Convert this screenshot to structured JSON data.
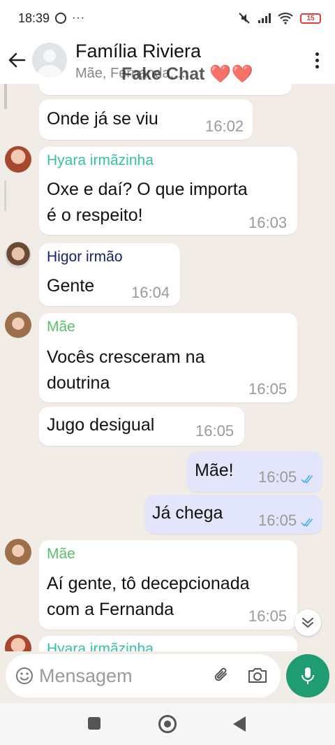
{
  "status_bar": {
    "time": "18:39",
    "dots": "···",
    "battery": "15"
  },
  "header": {
    "title": "Família Riviera",
    "subtitle": "Mãe, Fernanda, ...",
    "watermark": "Fake Chat ❤️❤️"
  },
  "colors": {
    "accent_green": "#1f9c72",
    "sender_hyara": "#35c2a0",
    "sender_higor": "#1b1f6b",
    "sender_mae": "#5bbf6a",
    "tick_blue": "#4fb1e9"
  },
  "messages": [
    {
      "type": "incoming",
      "text": "Onde já se viu",
      "time": "16:02"
    },
    {
      "type": "incoming",
      "sender": "Hyara irmãzinha",
      "text_line1": "Oxe e daí? O que importa",
      "text_line2": "é o respeito!",
      "time": "16:03"
    },
    {
      "type": "incoming",
      "sender": "Higor irmão",
      "text": "Gente",
      "time": "16:04"
    },
    {
      "type": "incoming",
      "sender": "Mãe",
      "text_line1": "Vocês cresceram na",
      "text_line2": "doutrina",
      "time": "16:05"
    },
    {
      "type": "incoming",
      "text": "Jugo desigual",
      "time": "16:05"
    },
    {
      "type": "outgoing",
      "text": "Mãe!",
      "time": "16:05",
      "ticks": "read"
    },
    {
      "type": "outgoing",
      "text": "Já chega",
      "time": "16:05",
      "ticks": "read"
    },
    {
      "type": "incoming",
      "sender": "Mãe",
      "text_line1": "Aí gente, tô decepcionada",
      "text_line2": "com a Fernanda",
      "time": "16:05"
    },
    {
      "type": "incoming",
      "sender": "Hyara irmãzinha",
      "partial": true
    }
  ],
  "composer": {
    "placeholder": "Mensagem"
  }
}
